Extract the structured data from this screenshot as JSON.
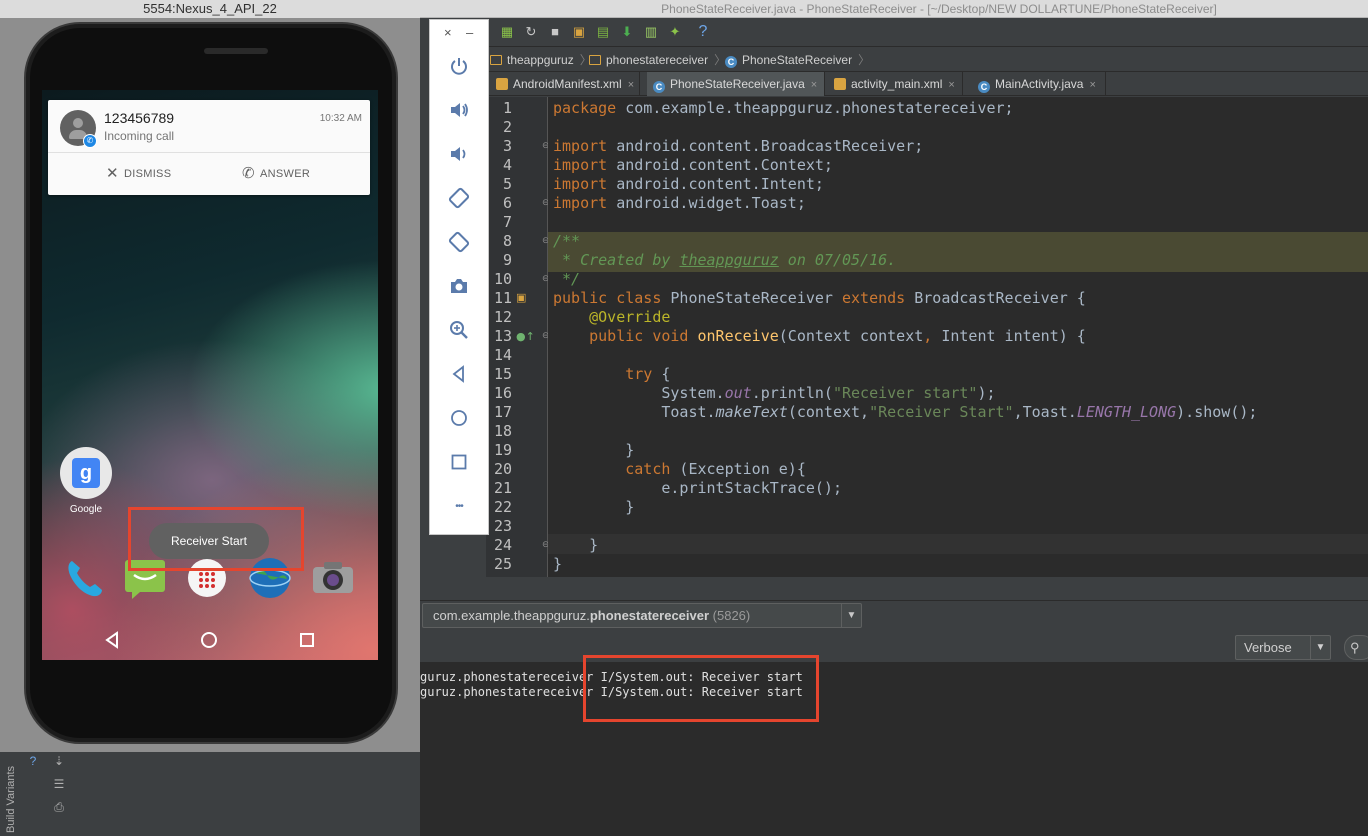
{
  "ide": {
    "window_title": "PhoneStateReceiver.java - PhoneStateReceiver - [~/Desktop/NEW DOLLARTUNE/PhoneStateReceiver]",
    "help_icon_label": "?",
    "breadcrumbs": [
      {
        "label": "theappguruz",
        "icon": "folder-icon"
      },
      {
        "label": "phonestatereceiver",
        "icon": "folder-icon"
      },
      {
        "label": "PhoneStateReceiver",
        "icon": "class-icon"
      }
    ],
    "tabs": [
      {
        "label": "AndroidManifest.xml",
        "active": false
      },
      {
        "label": "PhoneStateReceiver.java",
        "active": true
      },
      {
        "label": "activity_main.xml",
        "active": false
      },
      {
        "label": "MainActivity.java",
        "active": false
      }
    ],
    "class_letter": "C",
    "tab_close": "×",
    "line_numbers": [
      "1",
      "2",
      "3",
      "4",
      "5",
      "6",
      "7",
      "8",
      "9",
      "10",
      "11",
      "12",
      "13",
      "14",
      "15",
      "16",
      "17",
      "18",
      "19",
      "20",
      "21",
      "22",
      "23",
      "24",
      "25"
    ],
    "code": {
      "l1_kw": "package",
      "l1_rest": " com.example.theappguruz.phonestatereceiver;",
      "l3_kw": "import",
      "l3_rest": " android.content.BroadcastReceiver;",
      "l4_kw": "import",
      "l4_rest": " android.content.Context;",
      "l5_kw": "import",
      "l5_rest": " android.content.Intent;",
      "l6_kw": "import",
      "l6_rest": " android.widget.Toast;",
      "l8": "/**",
      "l9_a": " * Created by ",
      "l9_b": "theappguruz",
      "l9_c": " on 07/05/16.",
      "l10": " */",
      "l11_kw1": "public class",
      "l11_a": " PhoneStateReceiver ",
      "l11_kw2": "extends",
      "l11_b": " BroadcastReceiver {",
      "l12": "    @Override",
      "l13_kw": "    public void",
      "l13_fn": " onReceive",
      "l13_a": "(Context context",
      "l13_comma": ",",
      "l13_b": " Intent intent) {",
      "l15_kw": "        try",
      "l15_rest": " {",
      "l16_a": "            System.",
      "l16_out": "out",
      "l16_b": ".println(",
      "l16_str": "\"Receiver start\"",
      "l16_c": ");",
      "l17_a": "            Toast.",
      "l17_fn": "makeText",
      "l17_b": "(context,",
      "l17_str": "\"Receiver Start\"",
      "l17_c": ",Toast.",
      "l17_const": "LENGTH_LONG",
      "l17_d": ").show();",
      "l19": "        }",
      "l20_kw": "        catch",
      "l20_rest": " (Exception e){",
      "l21": "            e.printStackTrace();",
      "l22": "        }",
      "l24": "    }",
      "l25": "}"
    },
    "logcat": {
      "process": "com.example.theappguruz.",
      "process_bold": "phonestatereceiver",
      "process_pid": " (5826)",
      "level": "Verbose",
      "lines": [
        {
          "tag": "guruz.phonestatereceiver",
          "msg": " I/System.out: Receiver start"
        },
        {
          "tag": "guruz.phonestatereceiver",
          "msg": " I/System.out: Receiver start"
        }
      ]
    },
    "build_variants_label": "Build Variants"
  },
  "emulator": {
    "window_title": "5554:Nexus_4_API_22",
    "notification": {
      "title": "123456789",
      "subtitle": "Incoming call",
      "time": "10:32 AM",
      "dismiss": "DISMISS",
      "answer": "ANSWER"
    },
    "google_label": "Google",
    "toast": "Receiver Start",
    "panel_close": "×",
    "panel_min": "–",
    "panel_more": "•••"
  },
  "colors": {
    "highlight": "#e5452e",
    "editor_bg": "#2b2b2b",
    "keyword": "#cc7832",
    "string": "#6a8759",
    "comment": "#629755"
  }
}
